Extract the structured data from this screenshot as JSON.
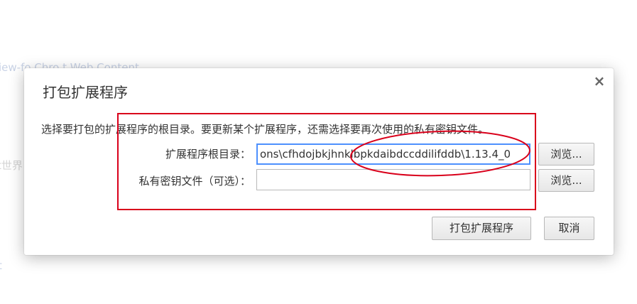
{
  "background": {
    "text1": "iew-fo  Chro         t  Web Content",
    "text2": "t世界",
    "text3": "t"
  },
  "dialog": {
    "title": "打包扩展程序",
    "close_glyph": "×",
    "description": "选择要打包的扩展程序的根目录。要更新某个扩展程序，还需选择要再次使用的私有密钥文件。",
    "root_dir_label": "扩展程序根目录：",
    "root_dir_value": "ons\\cfhdojbkjhnklbpkdaibdccddilifddb\\1.13.4_0",
    "key_file_label": "私有密钥文件（可选）：",
    "key_file_value": "",
    "browse_label_1": "浏览...",
    "browse_label_2": "浏览...",
    "pack_button": "打包扩展程序",
    "cancel_button": "取消"
  },
  "annotation_colors": {
    "focus_border": "#4d90fe",
    "annotation_red": "#d9001b"
  }
}
